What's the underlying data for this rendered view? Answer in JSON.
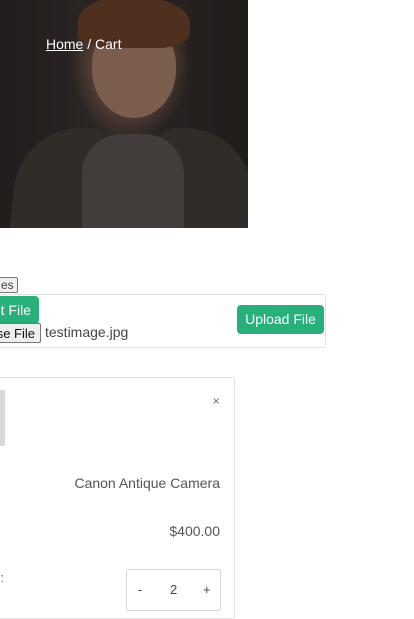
{
  "breadcrumb": {
    "home": "Home",
    "separator": " / ",
    "current": "Cart"
  },
  "upload": {
    "tag_text": "es",
    "select_file_label": "t File",
    "choose_file_label": "se File",
    "selected_file_name": "testimage.jpg",
    "upload_button_label": "Upload File"
  },
  "cart": {
    "remove_label": "×",
    "product_label": ":",
    "product_name": "Canon Antique Camera",
    "price": "$400.00",
    "quantity_label": "r:",
    "quantity": {
      "decrement": "-",
      "value": "2",
      "increment": "+"
    }
  },
  "colors": {
    "accent": "#27b07a"
  }
}
